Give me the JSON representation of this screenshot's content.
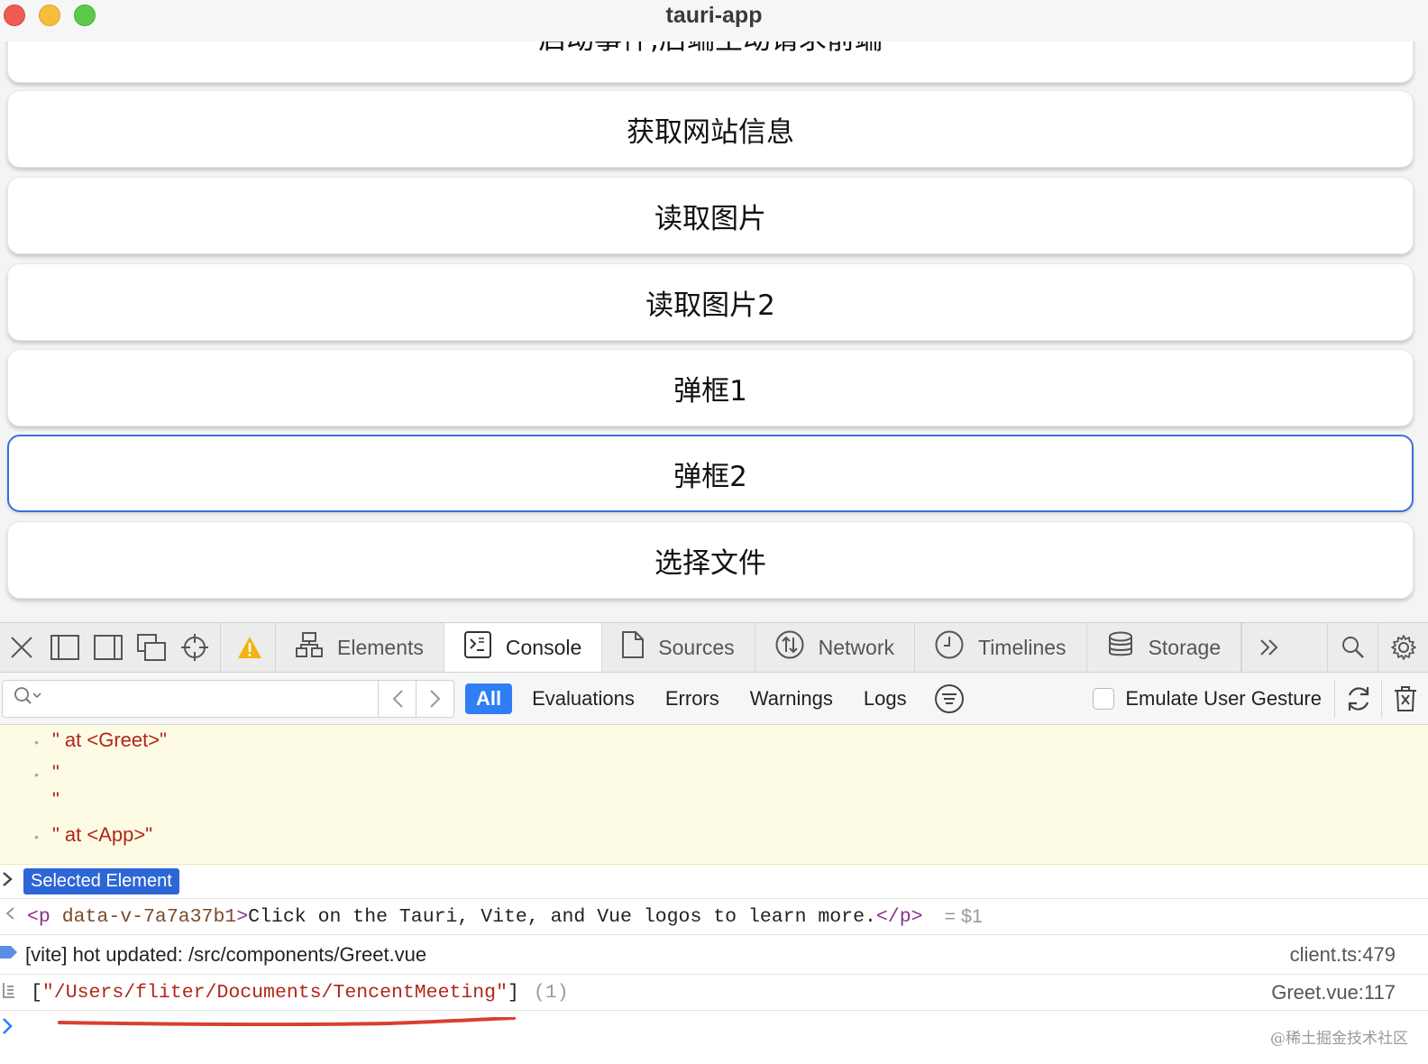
{
  "window": {
    "title": "tauri-app"
  },
  "app": {
    "buttons": [
      {
        "label": "启动事件,后端主动请求前端"
      },
      {
        "label": "获取网站信息"
      },
      {
        "label": "读取图片"
      },
      {
        "label": "读取图片2"
      },
      {
        "label": "弹框1"
      },
      {
        "label": "弹框2"
      },
      {
        "label": "选择文件"
      }
    ]
  },
  "devtools": {
    "tabs": [
      {
        "label": "Elements",
        "icon": "elements-icon"
      },
      {
        "label": "Console",
        "icon": "console-icon",
        "active": true
      },
      {
        "label": "Sources",
        "icon": "sources-icon"
      },
      {
        "label": "Network",
        "icon": "network-icon"
      },
      {
        "label": "Timelines",
        "icon": "timelines-icon"
      },
      {
        "label": "Storage",
        "icon": "storage-icon"
      }
    ],
    "filter": {
      "placeholder": "",
      "chips": [
        "All",
        "Evaluations",
        "Errors",
        "Warnings",
        "Logs"
      ],
      "emulate_label": "Emulate User Gesture"
    },
    "console": {
      "trace": [
        " \" at <Greet>\"",
        "\"",
        "\"",
        " \" at <App>\""
      ],
      "selected_badge": "Selected Element",
      "result_tag_open": "<p",
      "result_attr": "data-v-7a7a37b1",
      "result_tag_close_open": ">",
      "result_text": "Click on the Tauri, Vite, and Vue logos to learn more.",
      "result_tag_end": "</p>",
      "result_ref": "= $1",
      "vite_message": "[vite] hot updated: /src/components/Greet.vue",
      "vite_source": "client.ts:479",
      "array_open": "[",
      "array_value": "\"/Users/fliter/Documents/TencentMeeting\"",
      "array_close": "]",
      "array_count": "(1)",
      "array_source": "Greet.vue:117"
    },
    "colors": {
      "accent": "#2f7ef6",
      "badge": "#2d66d6",
      "warn_bg": "#fefbe5",
      "string": "#b1261a"
    }
  },
  "watermark": "@稀土掘金技术社区"
}
